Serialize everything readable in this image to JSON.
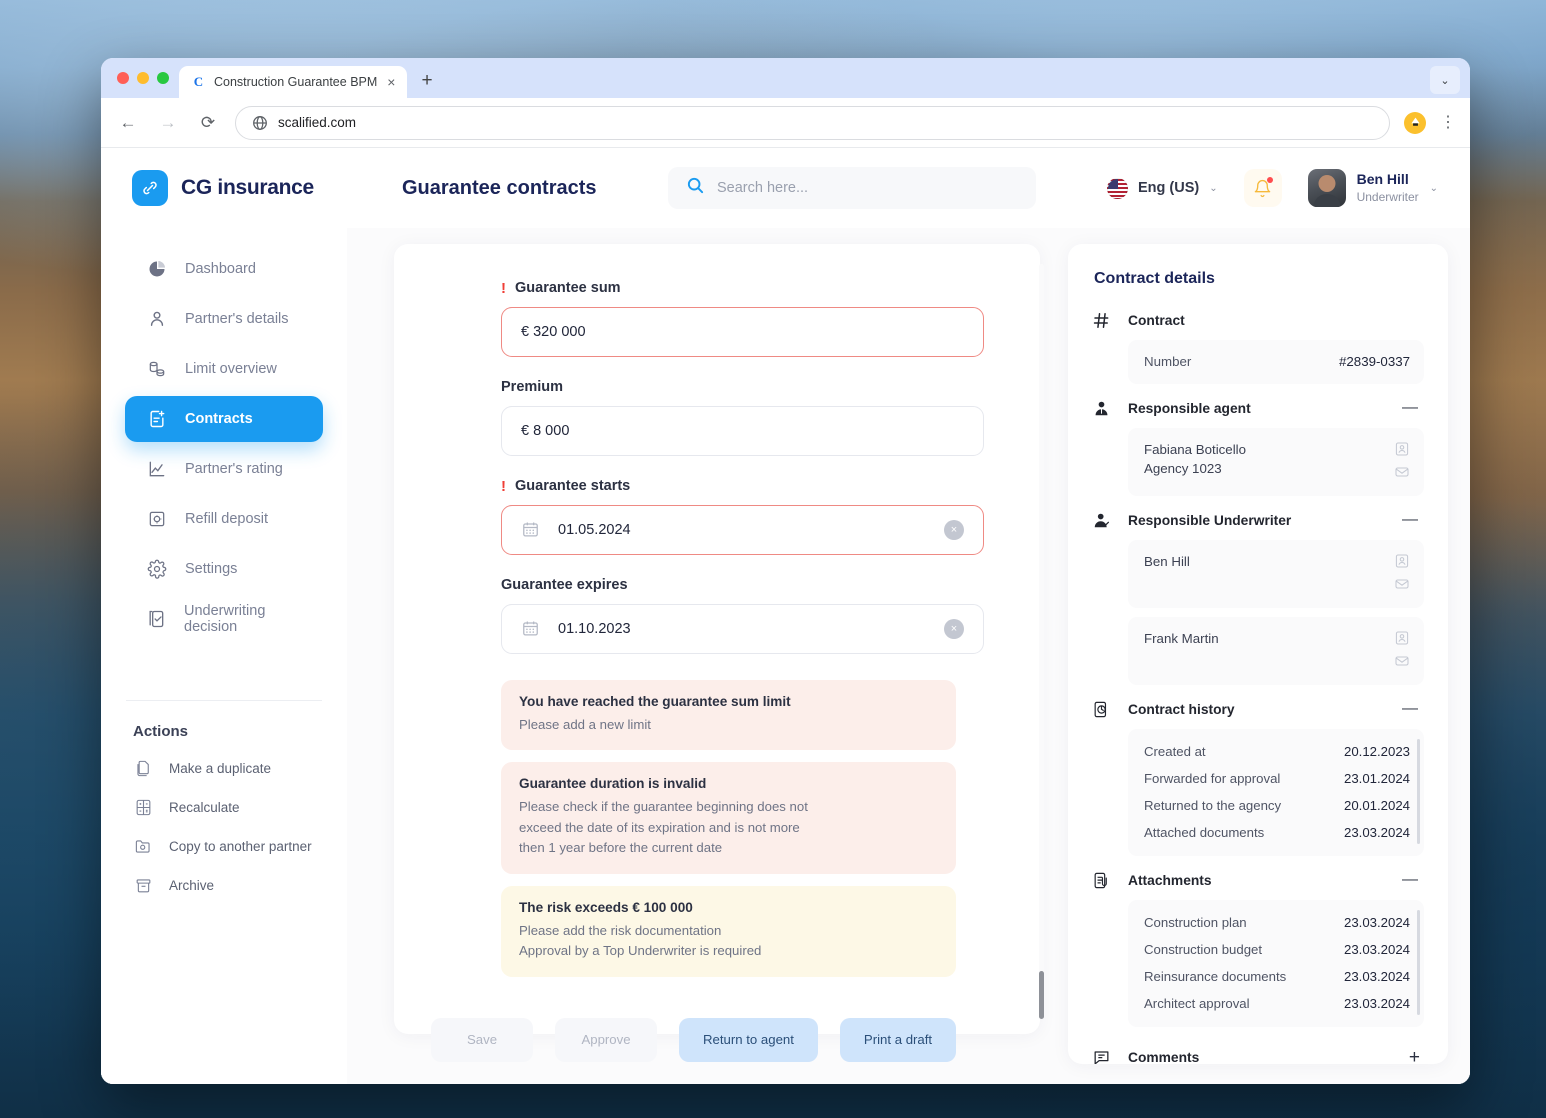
{
  "browser": {
    "tab_title": "Construction Guarantee BPM",
    "tab_favicon": "C",
    "close_icon": "×",
    "new_tab_icon": "+",
    "tabstrip_chevron": "⌄",
    "back_icon": "←",
    "forward_icon": "→",
    "reload_icon": "⟳",
    "url": "scalified.com",
    "kebab_icon": "⋮"
  },
  "header": {
    "brand_name": "CG insurance",
    "page_title": "Guarantee contracts",
    "search_placeholder": "Search here...",
    "language": "Eng (US)",
    "chevron": "⌄",
    "user_name": "Ben Hill",
    "user_role": "Underwriter"
  },
  "sidebar": {
    "items": [
      {
        "label": "Dashboard",
        "icon": "pie-chart-icon",
        "active": false
      },
      {
        "label": "Partner's details",
        "icon": "person-icon",
        "active": false
      },
      {
        "label": "Limit overview",
        "icon": "coins-icon",
        "active": false
      },
      {
        "label": "Contracts",
        "icon": "document-plus-icon",
        "active": true
      },
      {
        "label": "Partner's rating",
        "icon": "line-chart-icon",
        "active": false
      },
      {
        "label": "Refill deposit",
        "icon": "safe-icon",
        "active": false
      },
      {
        "label": "Settings",
        "icon": "gear-icon",
        "active": false
      },
      {
        "label": "Underwriting decision",
        "icon": "checklist-icon",
        "active": false
      }
    ],
    "actions_title": "Actions",
    "actions": [
      {
        "label": "Make a duplicate",
        "icon": "copy-icon"
      },
      {
        "label": "Recalculate",
        "icon": "calculator-icon"
      },
      {
        "label": "Copy to another partner",
        "icon": "folder-copy-icon"
      },
      {
        "label": "Archive",
        "icon": "archive-icon"
      }
    ]
  },
  "form": {
    "fields": [
      {
        "label": "Guarantee sum",
        "required": true,
        "value": "€ 320 000",
        "type": "text",
        "error": true
      },
      {
        "label": "Premium",
        "required": false,
        "value": "€ 8 000",
        "type": "text",
        "error": false
      },
      {
        "label": "Guarantee starts",
        "required": true,
        "value": "01.05.2024",
        "type": "date",
        "error": true,
        "clear_icon": "×"
      },
      {
        "label": "Guarantee expires",
        "required": false,
        "value": "01.10.2023",
        "type": "date",
        "error": false,
        "clear_icon": "×"
      }
    ],
    "required_marker": "!",
    "alerts": [
      {
        "tone": "pink",
        "title": "You have reached the guarantee sum limit",
        "lines": [
          "Please add a new limit"
        ]
      },
      {
        "tone": "pink",
        "title": "Guarantee duration is invalid",
        "lines": [
          "Please check if the guarantee beginning does not",
          "exceed the date of its expiration and is not more",
          "then 1 year before the current date"
        ]
      },
      {
        "tone": "cream",
        "title": "The risk exceeds € 100 000",
        "lines": [
          "Please add the risk documentation",
          "Approval by a Top Underwriter is required"
        ]
      }
    ],
    "buttons": [
      {
        "label": "Save",
        "style": "ghost"
      },
      {
        "label": "Approve",
        "style": "ghost"
      },
      {
        "label": "Return to agent",
        "style": "soft"
      },
      {
        "label": "Print a draft",
        "style": "soft"
      }
    ]
  },
  "details": {
    "title": "Contract details",
    "contract": {
      "section_label": "Contract",
      "icon": "hash-icon",
      "number_label": "Number",
      "number_value": "#2839-0337"
    },
    "responsible_agent": {
      "section_label": "Responsible agent",
      "icon": "agent-icon",
      "toggle": "—",
      "people": [
        {
          "name": "Fabiana Boticello",
          "sub": "Agency 1023"
        }
      ]
    },
    "responsible_underwriter": {
      "section_label": "Responsible Underwriter",
      "icon": "underwriter-icon",
      "toggle": "—",
      "people": [
        {
          "name": "Ben Hill",
          "sub": ""
        },
        {
          "name": "Frank Martin",
          "sub": ""
        }
      ]
    },
    "contract_history": {
      "section_label": "Contract history",
      "icon": "history-icon",
      "toggle": "—",
      "rows": [
        {
          "label": "Created at",
          "date": "20.12.2023"
        },
        {
          "label": "Forwarded for approval",
          "date": "23.01.2024"
        },
        {
          "label": "Returned to the agency",
          "date": "20.01.2024"
        },
        {
          "label": "Attached documents",
          "date": "23.03.2024"
        }
      ]
    },
    "attachments": {
      "section_label": "Attachments",
      "icon": "attachment-doc-icon",
      "toggle": "—",
      "rows": [
        {
          "label": "Construction plan",
          "date": "23.03.2024"
        },
        {
          "label": "Construction budget",
          "date": "23.03.2024"
        },
        {
          "label": "Reinsurance documents",
          "date": "23.03.2024"
        },
        {
          "label": "Architect approval",
          "date": "23.03.2024"
        }
      ]
    },
    "comments": {
      "section_label": "Comments",
      "icon": "comment-icon",
      "toggle": "+"
    }
  },
  "colors": {
    "accent": "#1a9bf0",
    "title": "#1b2559",
    "error": "#ef3e36",
    "alert_pink": "#fceeea",
    "alert_cream": "#fdf8e6",
    "soft_button": "#cfe4fb"
  }
}
